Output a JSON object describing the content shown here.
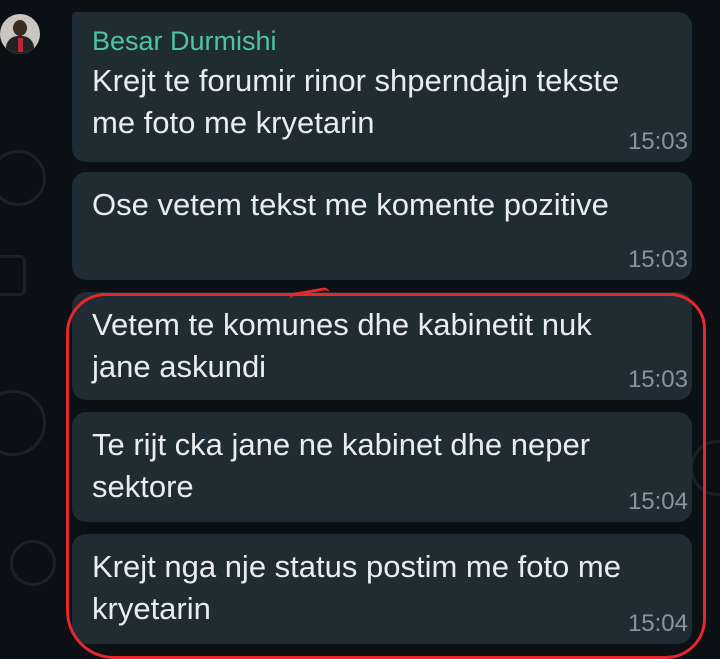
{
  "chat": {
    "sender_name": "Besar Durmishi",
    "messages": [
      {
        "text": "Krejt te forumir rinor shperndajn tekste me foto me kryetarin",
        "time": "15:03"
      },
      {
        "text": "Ose vetem tekst me komente pozitive",
        "time": "15:03"
      },
      {
        "text": "Vetem te komunes dhe kabinetit nuk jane askundi",
        "time": "15:03"
      },
      {
        "text": "Te rijt cka jane ne kabinet dhe neper sektore",
        "time": "15:04"
      },
      {
        "text": "Krejt nga nje status postim me foto me kryetarin",
        "time": "15:04"
      }
    ]
  },
  "colors": {
    "background": "#0b1014",
    "bubble": "#1f2c34",
    "sender": "#4fc3a6",
    "text": "#e9edef",
    "timestamp": "#8696a0",
    "highlight": "#e8262d"
  },
  "icons": {
    "avatar": "profile-photo"
  }
}
